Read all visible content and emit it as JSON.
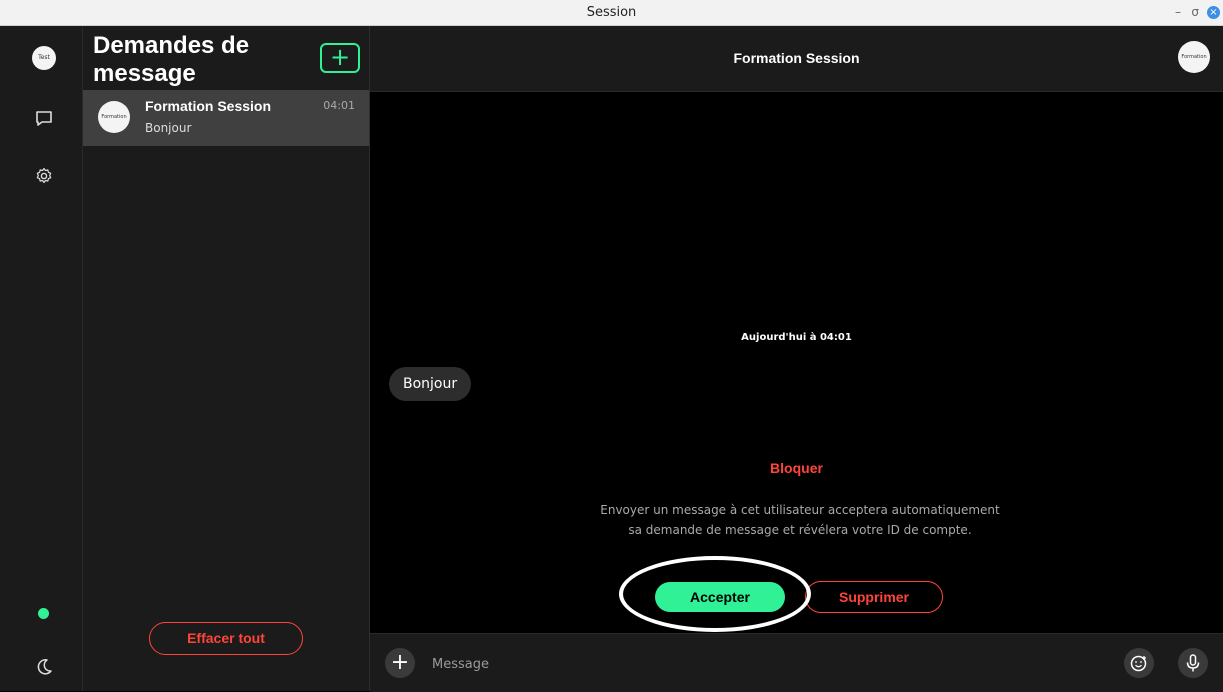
{
  "window": {
    "title": "Session",
    "controls": {
      "minimize": "–",
      "maximize": "σ",
      "close": "×"
    }
  },
  "nav": {
    "avatar_text": "Test",
    "items": [
      {
        "icon": "chat-bubble-icon"
      },
      {
        "icon": "gear-icon"
      }
    ],
    "status_color": "#31f196",
    "theme_icon": "moon-icon"
  },
  "requests_panel": {
    "title": "Demandes de message",
    "compose_icon": "plus-icon",
    "items": [
      {
        "avatar_text": "Formation",
        "name": "Formation Session",
        "time": "04:01",
        "preview": "Bonjour"
      }
    ],
    "clear_all_label": "Effacer tout"
  },
  "conversation": {
    "title": "Formation Session",
    "avatar_text": "Formation",
    "date_separator": "Aujourd'hui à 04:01",
    "messages": [
      {
        "text": "Bonjour",
        "direction": "incoming"
      }
    ],
    "block_label": "Bloquer",
    "info_text": "Envoyer un message à cet utilisateur acceptera automatiquement sa demande de message et révélera votre ID de compte.",
    "accept_label": "Accepter",
    "delete_label": "Supprimer"
  },
  "composer": {
    "placeholder": "Message",
    "add_icon": "plus-icon",
    "emoji_icon": "emoji-icon",
    "mic_icon": "microphone-icon"
  },
  "colors": {
    "accent": "#31f196",
    "danger": "#ff453a",
    "panel": "#1b1b1b",
    "selected": "#404040"
  }
}
